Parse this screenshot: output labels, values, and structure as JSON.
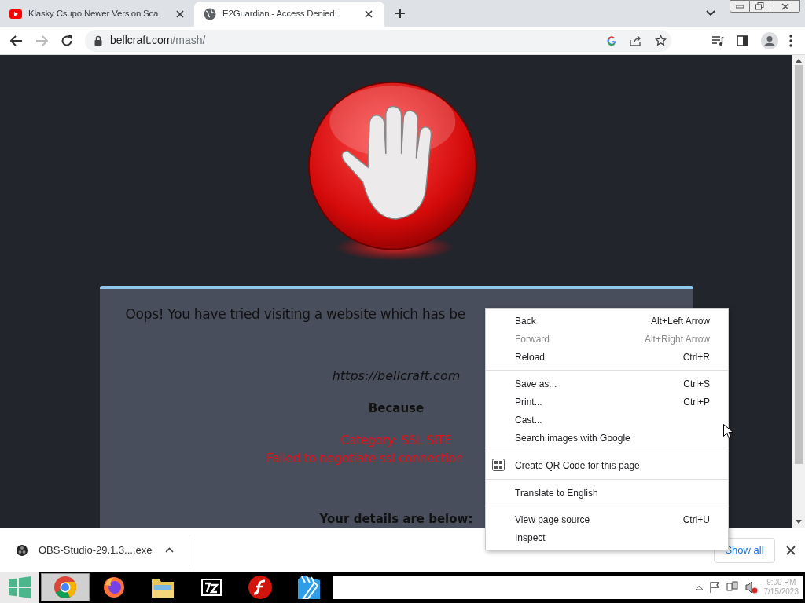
{
  "tabs": [
    {
      "title": "Klasky Csupo Newer Version Sca",
      "selected": false
    },
    {
      "title": "E2Guardian - Access Denied",
      "selected": true
    }
  ],
  "address_bar": {
    "domain": "bellcraft.com",
    "path": "/mash/"
  },
  "navigation": {
    "back_disabled": false,
    "forward_disabled": true
  },
  "page": {
    "heading": "Oops! You have tried visiting a website which has be",
    "url": "https://bellcraft.com",
    "because": "Because",
    "reasons": [
      "Category: SSL SITE",
      "Failed to negotiate ssl connection"
    ],
    "details": "Your details are below:"
  },
  "context_menu": [
    {
      "kind": "item",
      "label": "Back",
      "shortcut": "Alt+Left Arrow",
      "disabled": false
    },
    {
      "kind": "item",
      "label": "Forward",
      "shortcut": "Alt+Right Arrow",
      "disabled": true
    },
    {
      "kind": "item",
      "label": "Reload",
      "shortcut": "Ctrl+R",
      "disabled": false
    },
    {
      "kind": "separator"
    },
    {
      "kind": "item",
      "label": "Save as...",
      "shortcut": "Ctrl+S",
      "disabled": false
    },
    {
      "kind": "item",
      "label": "Print...",
      "shortcut": "Ctrl+P",
      "disabled": false
    },
    {
      "kind": "item",
      "label": "Cast...",
      "disabled": false
    },
    {
      "kind": "item",
      "label": "Search images with Google",
      "disabled": false
    },
    {
      "kind": "separator"
    },
    {
      "kind": "qr",
      "label": "Create QR Code for this page",
      "disabled": false
    },
    {
      "kind": "separator"
    },
    {
      "kind": "item",
      "label": "Translate to English",
      "disabled": false
    },
    {
      "kind": "separator"
    },
    {
      "kind": "item",
      "label": "View page source",
      "shortcut": "Ctrl+U",
      "disabled": false
    },
    {
      "kind": "item",
      "label": "Inspect",
      "disabled": false
    }
  ],
  "download_bar": {
    "file": "OBS-Studio-29.1.3....exe",
    "show_all": "Show all"
  },
  "taskbar": {
    "apps": [
      {
        "kind": "chrome",
        "selected": true
      },
      {
        "kind": "firefox",
        "selected": false
      },
      {
        "kind": "explorer",
        "selected": false
      },
      {
        "kind": "sevenzip",
        "selected": false
      },
      {
        "kind": "flash",
        "selected": false
      },
      {
        "kind": "editor",
        "selected": false
      }
    ],
    "time": "9:00 PM",
    "date": "7/15/2023"
  }
}
